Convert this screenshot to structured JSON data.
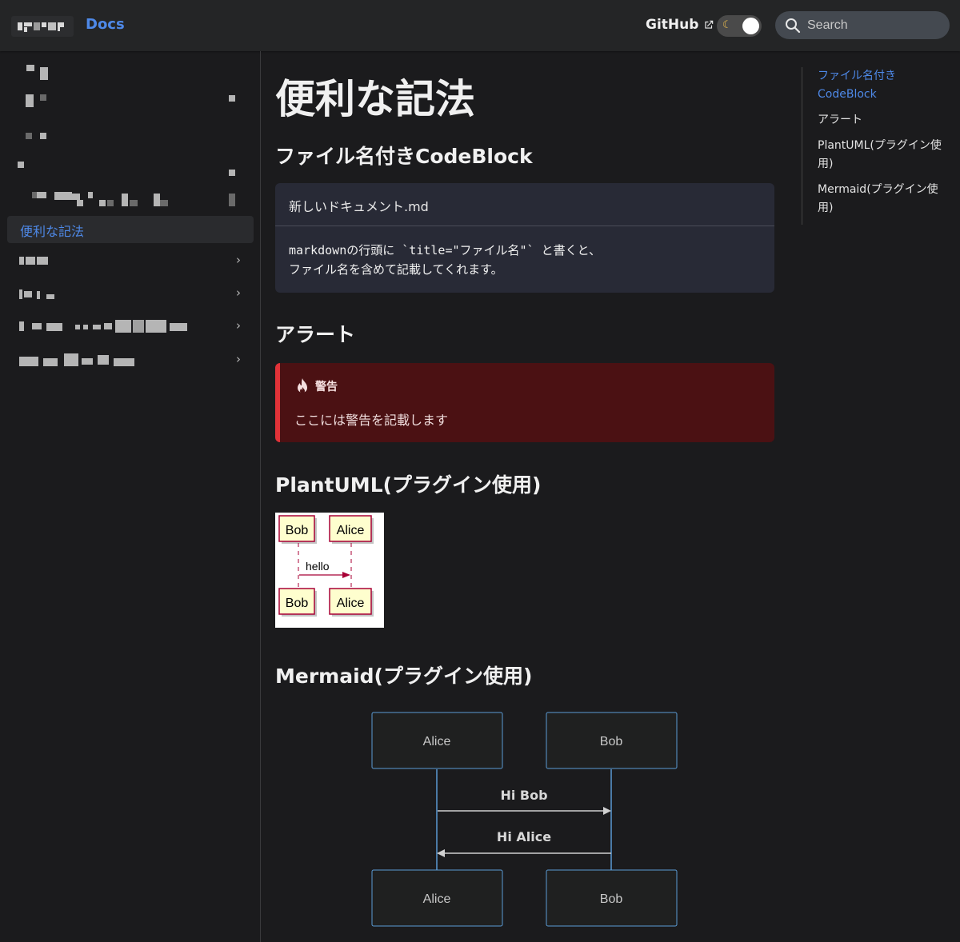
{
  "navbar": {
    "brand": "Docs",
    "github_label": "GitHub",
    "search_placeholder": "Search"
  },
  "sidebar": {
    "active_item": "便利な記法"
  },
  "article": {
    "title": "便利な記法",
    "sections": {
      "codeblock_heading": "ファイル名付きCodeBlock",
      "alert_heading": "アラート",
      "plantuml_heading": "PlantUML(プラグイン使用)",
      "mermaid_heading": "Mermaid(プラグイン使用)"
    },
    "codeblock": {
      "filename": "新しいドキュメント.md",
      "line1": "markdownの行頭に `title=\"ファイル名\"` と書くと、",
      "line2": "ファイル名を含めて記載してくれます。"
    },
    "alert": {
      "label": "警告",
      "text": "ここには警告を記載します"
    },
    "plantuml": {
      "participant_a": "Bob",
      "participant_b": "Alice",
      "message": "hello"
    },
    "mermaid": {
      "participant_a": "Alice",
      "participant_b": "Bob",
      "message1": "Hi Bob",
      "message2": "Hi Alice"
    }
  },
  "toc": {
    "items": [
      "ファイル名付きCodeBlock",
      "アラート",
      "PlantUML(プラグイン使用)",
      "Mermaid(プラグイン使用)"
    ]
  },
  "colors": {
    "accent": "#4e89e8",
    "alert_border": "#e13238",
    "alert_bg": "#4b1113",
    "mermaid_stroke": "#5b9bd5"
  }
}
